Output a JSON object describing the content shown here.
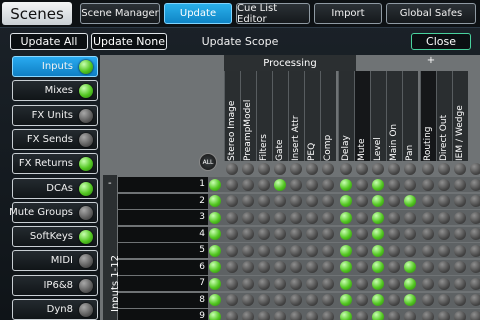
{
  "header": {
    "title": "Scenes",
    "tabs": [
      {
        "label": "Scene Manager",
        "active": false
      },
      {
        "label": "Update",
        "active": true
      },
      {
        "label": "Cue List Editor",
        "active": false
      },
      {
        "label": "Import",
        "active": false
      },
      {
        "label": "Global Safes",
        "active": false
      }
    ]
  },
  "scope": {
    "update_all": "Update All",
    "update_none": "Update None",
    "title": "Update Scope",
    "close": "Close"
  },
  "sidebar": {
    "items": [
      {
        "label": "Inputs",
        "on": true,
        "active": true
      },
      {
        "label": "Mixes",
        "on": true,
        "active": false
      },
      {
        "label": "FX Units",
        "on": false,
        "active": false
      },
      {
        "label": "FX Sends",
        "on": false,
        "active": false
      },
      {
        "label": "FX Returns",
        "on": true,
        "active": false
      },
      {
        "label": "DCAs",
        "on": true,
        "active": false
      },
      {
        "label": "Mute Groups",
        "on": false,
        "active": false
      },
      {
        "label": "SoftKeys",
        "on": true,
        "active": false
      },
      {
        "label": "MIDI",
        "on": false,
        "active": false
      },
      {
        "label": "IP6&8",
        "on": false,
        "active": false
      },
      {
        "label": "Dyn8",
        "on": false,
        "active": false
      }
    ]
  },
  "matrix": {
    "processing_label": "Processing",
    "plus_label": "+",
    "all_label": "ALL",
    "group_label": "Inputs 1-12",
    "group_dash": "-",
    "columns": [
      "Stereo Image",
      "PreampModel",
      "Filters",
      "Gate",
      "Insert Attr",
      "PEQ",
      "Comp",
      "Delay",
      "Mute",
      "Level",
      "Main On",
      "Pan",
      "Routing",
      "Direct Out",
      "IEM / Wedge"
    ],
    "rows": [
      {
        "num": "1",
        "cells": [
          0,
          0,
          0,
          1,
          0,
          0,
          0,
          1,
          0,
          1,
          0,
          0,
          0,
          0,
          0,
          0
        ]
      },
      {
        "num": "2",
        "cells": [
          0,
          0,
          0,
          0,
          0,
          0,
          0,
          1,
          0,
          1,
          0,
          1,
          0,
          0,
          0,
          0
        ]
      },
      {
        "num": "3",
        "cells": [
          0,
          0,
          0,
          0,
          0,
          0,
          0,
          1,
          0,
          1,
          0,
          0,
          0,
          0,
          0,
          0
        ]
      },
      {
        "num": "4",
        "cells": [
          0,
          0,
          0,
          0,
          0,
          0,
          0,
          1,
          0,
          1,
          0,
          0,
          0,
          0,
          0,
          0
        ]
      },
      {
        "num": "5",
        "cells": [
          0,
          0,
          0,
          0,
          0,
          0,
          0,
          1,
          0,
          1,
          0,
          0,
          0,
          0,
          0,
          0
        ]
      },
      {
        "num": "6",
        "cells": [
          0,
          0,
          0,
          0,
          0,
          0,
          0,
          1,
          0,
          1,
          0,
          1,
          0,
          0,
          0,
          0
        ]
      },
      {
        "num": "7",
        "cells": [
          0,
          0,
          0,
          0,
          0,
          0,
          0,
          1,
          0,
          1,
          0,
          1,
          0,
          0,
          0,
          0
        ]
      },
      {
        "num": "8",
        "cells": [
          0,
          0,
          0,
          0,
          0,
          0,
          0,
          1,
          0,
          1,
          0,
          1,
          0,
          0,
          0,
          0
        ]
      },
      {
        "num": "9",
        "cells": [
          0,
          0,
          0,
          0,
          0,
          0,
          0,
          1,
          0,
          1,
          0,
          0,
          0,
          0,
          0,
          0
        ]
      }
    ],
    "all_cells": [
      0,
      0,
      0,
      0,
      0,
      0,
      0,
      0,
      0,
      0,
      0,
      0,
      0,
      0,
      0,
      0
    ]
  },
  "colors": {
    "accent": "#1a9be0",
    "on": "#52c620",
    "off": "#5b5b5b",
    "close_border": "#49d29e"
  }
}
